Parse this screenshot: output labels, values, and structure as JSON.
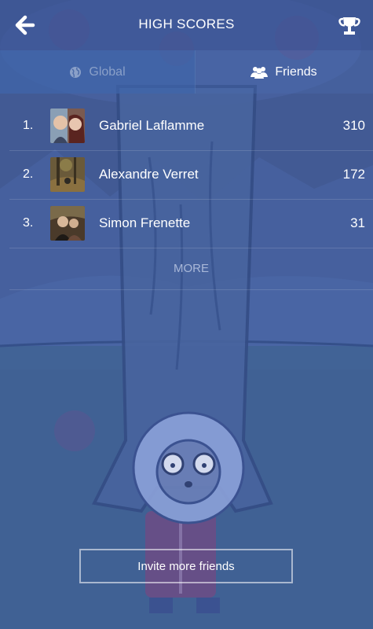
{
  "header": {
    "title": "HIGH SCORES",
    "back_icon": "arrow-left-icon",
    "trophy_icon": "trophy-icon"
  },
  "tabs": [
    {
      "label": "Global",
      "icon": "globe-icon",
      "active": false
    },
    {
      "label": "Friends",
      "icon": "users-icon",
      "active": true
    }
  ],
  "leaderboard": [
    {
      "rank": "1.",
      "name": "Gabriel Laflamme",
      "score": "310"
    },
    {
      "rank": "2.",
      "name": "Alexandre Verret",
      "score": "172"
    },
    {
      "rank": "3.",
      "name": "Simon Frenette",
      "score": "31"
    }
  ],
  "more_label": "MORE",
  "invite_label": "Invite more friends",
  "colors": {
    "background": "#3f5a90",
    "header": "#4a62a0",
    "active_tab_text": "#ffffff",
    "inactive_tab_text": "#8aa0c8"
  }
}
